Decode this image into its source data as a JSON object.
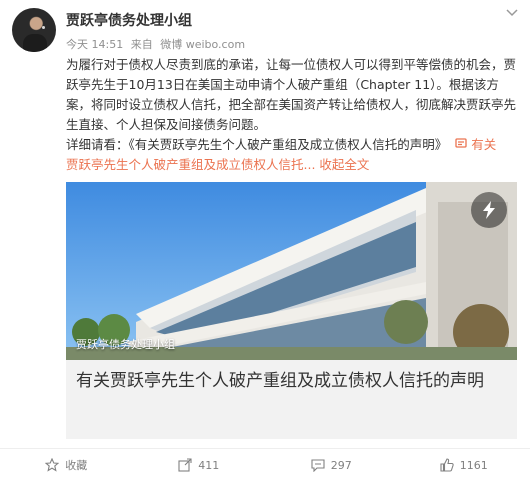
{
  "post": {
    "author": "贾跃亭债务处理小组",
    "time": "今天 14:51",
    "source_prefix": "来自",
    "source": "微博 weibo.com",
    "body_paragraph": "为履行对于债权人尽责到底的承诺，让每一位债权人可以得到平等偿债的机会，贾跃亭先生于10月13日在美国主动申请个人破产重组（Chapter 11）。根据该方案，将同时设立债权人信托，把全部在美国资产转让给债权人，彻底解决贾跃亭先生直接、个人担保及间接债务问题。",
    "detail_prefix": "详细请看：《有关贾跃亭先生个人破产重组及成立债权人信托的声明》",
    "detail_link": "有关",
    "detail_link_line2": "贾跃亭先生个人破产重组及成立债权人信托...",
    "collapse_label": "收起全文"
  },
  "card": {
    "image_label": "贾跃亭债务处理小组",
    "title": "有关贾跃亭先生个人破产重组及成立债权人信托的声明"
  },
  "actions": {
    "favorite_label": "收藏",
    "repost_count": "411",
    "comment_count": "297",
    "like_count": "1161"
  },
  "colors": {
    "link": "#eb7350",
    "meta_text": "#8f8f8f",
    "card_bg": "#f2f2f2"
  },
  "icons": [
    "chevron-down-icon",
    "link-icon",
    "flash-icon",
    "star-icon",
    "repost-icon",
    "comment-icon",
    "like-icon"
  ]
}
